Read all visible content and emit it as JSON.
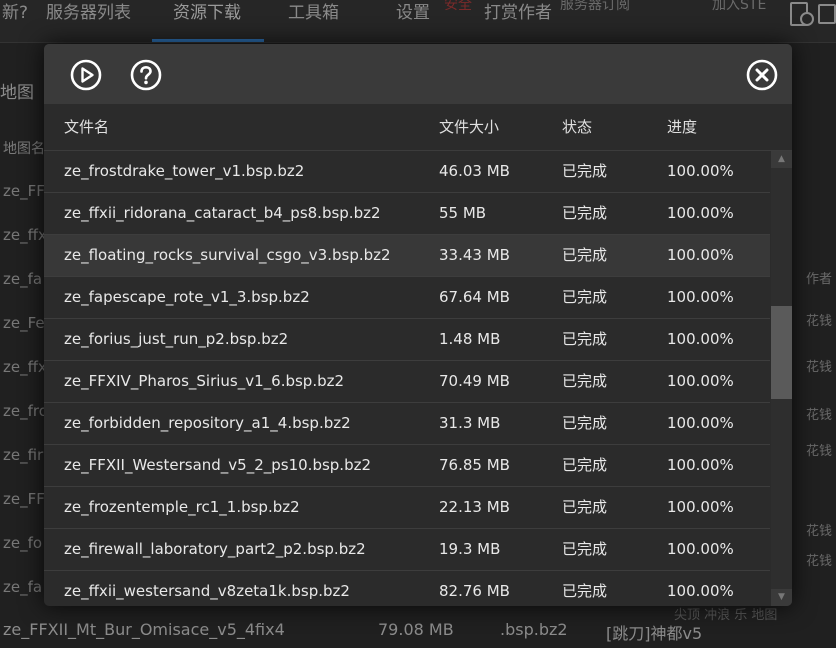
{
  "background": {
    "tabs": [
      {
        "label": "新? "
      },
      {
        "label": "服务器列表"
      },
      {
        "label": "资源下载"
      },
      {
        "label": "工具箱"
      },
      {
        "label": "设置"
      },
      {
        "label": "打赏作者"
      }
    ],
    "top_fragments": {
      "red": "安全",
      "gray": "服务器订阅",
      "right": "加入STE"
    },
    "side_title": "地图",
    "column_header": "地图名",
    "left_rows": [
      "ze_FF",
      "ze_ffx",
      "ze_fa",
      "ze_Fe",
      "ze_ffx",
      "ze_fro",
      "ze_fir",
      "ze_FF",
      "ze_fo",
      "ze_fa"
    ],
    "right_fragments": [
      "作者",
      "花钱",
      "花钱",
      "花钱",
      "花钱",
      "花钱",
      "花钱"
    ],
    "bottom_row": {
      "name": "ze_FFXII_Mt_Bur_Omisace_v5_4fix4",
      "size": "79.08 MB",
      "ext": ".bsp.bz2",
      "desc": "[跳刀]神都v5"
    },
    "bottom_sub": "尖顶 冲浪 乐 地图"
  },
  "modal": {
    "toolbar": {
      "play_icon": "play-circle-icon",
      "help_icon": "help-circle-icon",
      "close_icon": "close-circle-icon"
    },
    "columns": {
      "name": "文件名",
      "size": "文件大小",
      "status": "状态",
      "progress": "进度"
    },
    "rows": [
      {
        "name": "ze_frostdrake_tower_v1.bsp.bz2",
        "size": "46.03 MB",
        "status": "已完成",
        "progress": "100.00%"
      },
      {
        "name": "ze_ffxii_ridorana_cataract_b4_ps8.bsp.bz2",
        "size": "55 MB",
        "status": "已完成",
        "progress": "100.00%"
      },
      {
        "name": "ze_floating_rocks_survival_csgo_v3.bsp.bz2",
        "size": "33.43 MB",
        "status": "已完成",
        "progress": "100.00%"
      },
      {
        "name": "ze_fapescape_rote_v1_3.bsp.bz2",
        "size": "67.64 MB",
        "status": "已完成",
        "progress": "100.00%"
      },
      {
        "name": "ze_forius_just_run_p2.bsp.bz2",
        "size": "1.48 MB",
        "status": "已完成",
        "progress": "100.00%"
      },
      {
        "name": "ze_FFXIV_Pharos_Sirius_v1_6.bsp.bz2",
        "size": "70.49 MB",
        "status": "已完成",
        "progress": "100.00%"
      },
      {
        "name": "ze_forbidden_repository_a1_4.bsp.bz2",
        "size": "31.3 MB",
        "status": "已完成",
        "progress": "100.00%"
      },
      {
        "name": "ze_FFXII_Westersand_v5_2_ps10.bsp.bz2",
        "size": "76.85 MB",
        "status": "已完成",
        "progress": "100.00%"
      },
      {
        "name": "ze_frozentemple_rc1_1.bsp.bz2",
        "size": "22.13 MB",
        "status": "已完成",
        "progress": "100.00%"
      },
      {
        "name": "ze_firewall_laboratory_part2_p2.bsp.bz2",
        "size": "19.3 MB",
        "status": "已完成",
        "progress": "100.00%"
      }
    ],
    "partial_row": {
      "name": "ze_ffxii_westersand_v8zeta1k.bsp.bz2",
      "size": "82.76 MB",
      "status": "已完成",
      "progress": "100.00%"
    },
    "hover_row_index": 2,
    "scrollbar": {
      "up_arrow": "▲",
      "down_arrow": "▼",
      "scroll_position_fraction": 0.42,
      "visible_fraction": 0.22
    }
  }
}
